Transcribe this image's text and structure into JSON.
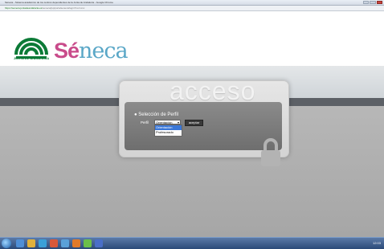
{
  "browser": {
    "title": "Séneca - Sistema académico de los centros dependientes de la Junta de Andalucía - Google Chrome",
    "url_host": "https://seneca.juntadeandalucia.es",
    "url_rest": "/seneca/jsp/portalseneca/login?no=xxxx"
  },
  "header": {
    "org_text": "JUNTA DE ANDALUCÍA",
    "brand_se": "Sé",
    "brand_neca": "neca"
  },
  "panel": {
    "watermark": "acceso",
    "section_title": "Selección de Perfil",
    "perfil_label": "Perfil",
    "perfil_selected": "Orientación",
    "aceptar_label": "aceptar",
    "options": [
      "Orientación",
      "Profesorado"
    ]
  },
  "taskbar": {
    "clock": "12:03"
  },
  "colors": {
    "brand_se": "#c94c8b",
    "brand_neca": "#5aa7c7",
    "junta_green": "#0b7a36",
    "highlight": "#3a77d8"
  }
}
